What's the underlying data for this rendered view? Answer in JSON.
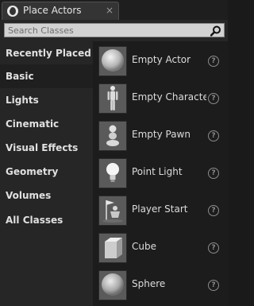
{
  "tab": {
    "title": "Place Actors",
    "close_glyph": "×",
    "icon": "unreal-logo-icon"
  },
  "search": {
    "placeholder": "Search Classes",
    "value": "",
    "icon": "search-icon"
  },
  "categories": [
    {
      "label": "Recently Placed",
      "selected": false
    },
    {
      "label": "Basic",
      "selected": true
    },
    {
      "label": "Lights",
      "selected": false
    },
    {
      "label": "Cinematic",
      "selected": false
    },
    {
      "label": "Visual Effects",
      "selected": false
    },
    {
      "label": "Geometry",
      "selected": false
    },
    {
      "label": "Volumes",
      "selected": false
    },
    {
      "label": "All Classes",
      "selected": false
    }
  ],
  "items": [
    {
      "label": "Empty Actor",
      "icon": "sphere-icon",
      "help": "?"
    },
    {
      "label": "Empty Character",
      "icon": "mannequin-icon",
      "help": "?"
    },
    {
      "label": "Empty Pawn",
      "icon": "pawn-icon",
      "help": "?"
    },
    {
      "label": "Point Light",
      "icon": "lightbulb-icon",
      "help": "?"
    },
    {
      "label": "Player Start",
      "icon": "player-start-icon",
      "help": "?"
    },
    {
      "label": "Cube",
      "icon": "cube-icon",
      "help": "?"
    },
    {
      "label": "Sphere",
      "icon": "sphere-icon",
      "help": "?"
    }
  ],
  "colors": {
    "selected_bg": "#1f1f1f",
    "panel_bg": "#262626",
    "list_bg": "#1c1c1c"
  }
}
